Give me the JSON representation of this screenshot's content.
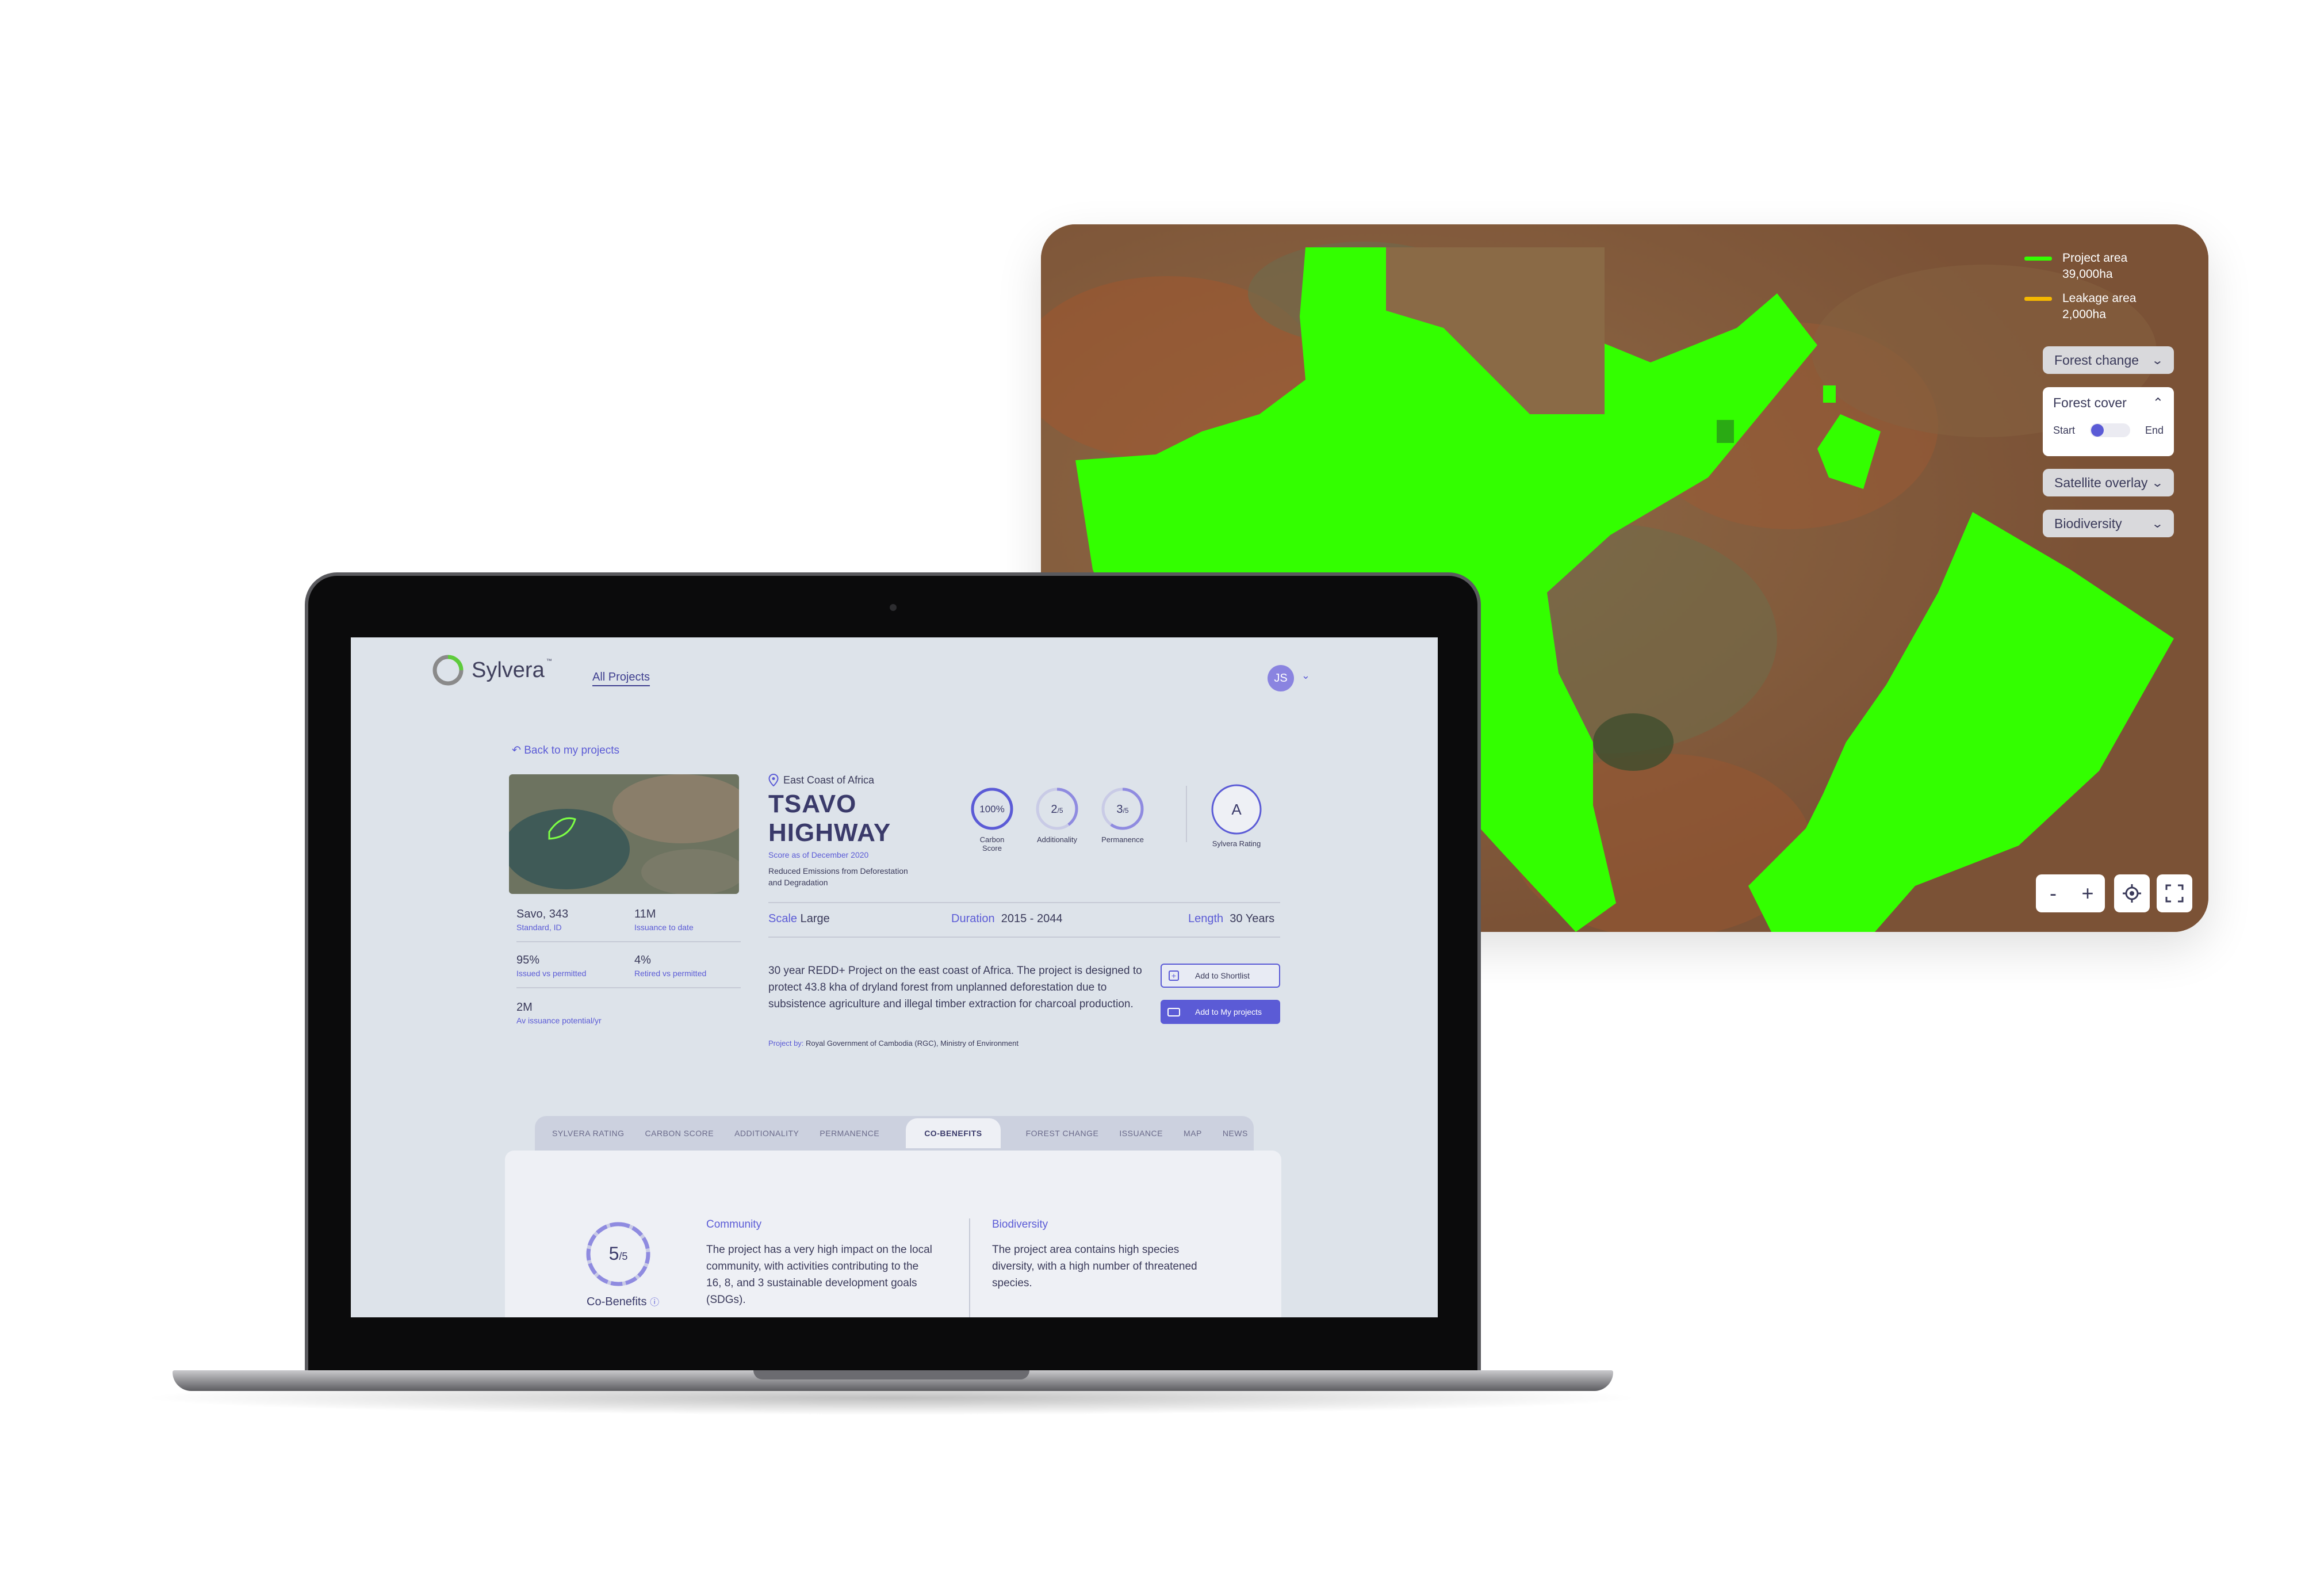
{
  "map": {
    "legend": [
      {
        "name": "Project area",
        "value": "39,000ha",
        "color": "#33ff00"
      },
      {
        "name": "Leakage area",
        "value": "2,000ha",
        "color": "#f5b800"
      }
    ],
    "controls": {
      "forest_change": "Forest change",
      "forest_cover": "Forest cover",
      "start": "Start",
      "end": "End",
      "satellite_overlay": "Satellite overlay",
      "biodiversity": "Biodiversity"
    },
    "zoom": {
      "minus": "-",
      "plus": "+"
    }
  },
  "app": {
    "brand": "Sylvera",
    "trademark": "™",
    "nav_all_projects": "All Projects",
    "user_initials": "JS"
  },
  "project": {
    "back": "Back to my projects",
    "location": "East Coast of Africa",
    "title": "TSAVO HIGHWAY",
    "score_as_of": "Score as of December 2020",
    "type": "Reduced Emissions from Deforestation and Degradation",
    "stats": [
      {
        "value": "Savo, 343",
        "label": "Standard, ID"
      },
      {
        "value": "11M",
        "label": "Issuance to date"
      },
      {
        "value": "95%",
        "label": "Issued vs permitted"
      },
      {
        "value": "4%",
        "label": "Retired vs permitted"
      },
      {
        "value": "2M",
        "label": "Av issuance potential/yr"
      }
    ],
    "scores": [
      {
        "value": "100%",
        "label": "Carbon Score",
        "fraction": 1.0
      },
      {
        "value": "2",
        "denom": "/5",
        "label": "Additionality",
        "fraction": 0.4
      },
      {
        "value": "3",
        "denom": "/5",
        "label": "Permanence",
        "fraction": 0.6
      }
    ],
    "rating": {
      "value": "A",
      "label": "Sylvera Rating"
    },
    "scale_label": "Scale",
    "scale": "Large",
    "duration_label": "Duration",
    "duration": "2015 - 2044",
    "length_label": "Length",
    "length": "30 Years",
    "description": "30 year REDD+ Project on the east coast of Africa. The project is designed to protect 43.8 kha of dryland forest from unplanned deforestation due to subsistence agriculture and illegal timber extraction for charcoal production.",
    "project_by_label": "Project by:",
    "project_by": "Royal Government of Cambodia (RGC), Ministry of Environment",
    "add_shortlist": "Add to Shortlist",
    "add_my_projects": "Add to My projects"
  },
  "tabs": [
    "SYLVERA RATING",
    "CARBON SCORE",
    "ADDITIONALITY",
    "PERMANENCE",
    "CO-BENEFITS",
    "FOREST CHANGE",
    "ISSUANCE",
    "MAP",
    "NEWS"
  ],
  "active_tab": "CO-BENEFITS",
  "cobenefits": {
    "score": "5",
    "denom": "/5",
    "fraction": 1.0,
    "label": "Co-Benefits",
    "community_title": "Community",
    "community_text": "The project has a very high impact on the local community, with activities contributing to the 16, 8, and 3 sustainable development goals (SDGs).",
    "biodiversity_title": "Biodiversity",
    "biodiversity_text": "The project area contains high species diversity, with a high number of threatened species."
  }
}
